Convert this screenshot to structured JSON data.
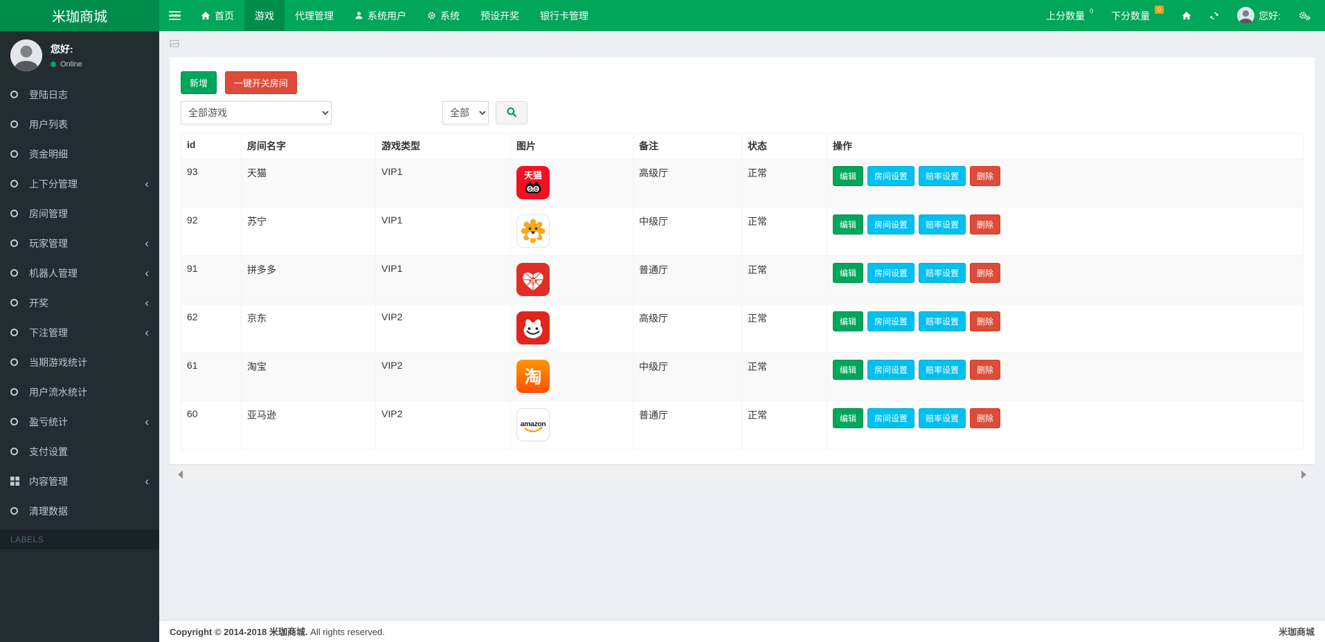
{
  "brand": "米珈商城",
  "navbar": {
    "menu": [
      {
        "name": "home",
        "label": "首页",
        "icon": "home",
        "active": false
      },
      {
        "name": "games",
        "label": "游戏",
        "active": true
      },
      {
        "name": "agents",
        "label": "代理管理",
        "active": false
      },
      {
        "name": "system-users",
        "label": "系统用户",
        "icon": "user",
        "active": false
      },
      {
        "name": "system",
        "label": "系统",
        "icon": "gear",
        "active": false
      },
      {
        "name": "preset-draw",
        "label": "预设开奖",
        "active": false
      },
      {
        "name": "bank-cards",
        "label": "银行卡管理",
        "active": false
      }
    ],
    "right": {
      "score_up_label": "上分数量",
      "score_up_badge": "0",
      "score_down_label": "下分数量",
      "score_down_badge": "0",
      "greeting": "您好:"
    }
  },
  "sidebar": {
    "user": {
      "greeting": "您好:",
      "status": "Online"
    },
    "menu": [
      {
        "name": "login-logs",
        "label": "登陆日志",
        "icon": "circle",
        "expandable": false
      },
      {
        "name": "user-list",
        "label": "用户列表",
        "icon": "circle",
        "expandable": false
      },
      {
        "name": "funds-detail",
        "label": "资金明细",
        "icon": "circle",
        "expandable": false
      },
      {
        "name": "score-management",
        "label": "上下分管理",
        "icon": "circle",
        "expandable": true
      },
      {
        "name": "room-management",
        "label": "房间管理",
        "icon": "circle",
        "expandable": false
      },
      {
        "name": "player-management",
        "label": "玩家管理",
        "icon": "circle",
        "expandable": true
      },
      {
        "name": "robot-management",
        "label": "机器人管理",
        "icon": "circle",
        "expandable": true
      },
      {
        "name": "draw",
        "label": "开奖",
        "icon": "circle",
        "expandable": true
      },
      {
        "name": "bet-management",
        "label": "下注管理",
        "icon": "circle",
        "expandable": true
      },
      {
        "name": "current-game-stats",
        "label": "当期游戏统计",
        "icon": "circle",
        "expandable": false
      },
      {
        "name": "user-flow-stats",
        "label": "用户流水统计",
        "icon": "circle",
        "expandable": false
      },
      {
        "name": "profit-stats",
        "label": "盈亏统计",
        "icon": "circle",
        "expandable": true
      },
      {
        "name": "payment-settings",
        "label": "支付设置",
        "icon": "circle",
        "expandable": false
      },
      {
        "name": "content-management",
        "label": "内容管理",
        "icon": "grid",
        "expandable": true
      },
      {
        "name": "clean-data",
        "label": "清理数据",
        "icon": "circle",
        "expandable": false
      }
    ],
    "labels_header": "LABELS"
  },
  "main": {
    "toolbar": {
      "add": "新增",
      "toggle_rooms": "一键开关房间"
    },
    "filters": {
      "game_select": "全部游戏",
      "status_select": "全部"
    },
    "table": {
      "headers": [
        "id",
        "房间名字",
        "游戏类型",
        "图片",
        "备注",
        "状态",
        "操作"
      ],
      "action_labels": [
        "编辑",
        "房间设置",
        "赔率设置",
        "删除"
      ],
      "rows": [
        {
          "id": "93",
          "name": "天猫",
          "type": "VIP1",
          "icon": "tmall-icon",
          "remark": "高级厅",
          "status": "正常"
        },
        {
          "id": "92",
          "name": "苏宁",
          "type": "VIP1",
          "icon": "suning-icon",
          "remark": "中级厅",
          "status": "正常"
        },
        {
          "id": "91",
          "name": "拼多多",
          "type": "VIP1",
          "icon": "pinduoduo-icon",
          "remark": "普通厅",
          "status": "正常"
        },
        {
          "id": "62",
          "name": "京东",
          "type": "VIP2",
          "icon": "jd-icon",
          "remark": "高级厅",
          "status": "正常"
        },
        {
          "id": "61",
          "name": "淘宝",
          "type": "VIP2",
          "icon": "taobao-icon",
          "remark": "中级厅",
          "status": "正常"
        },
        {
          "id": "60",
          "name": "亚马逊",
          "type": "VIP2",
          "icon": "amazon-icon",
          "remark": "普通厅",
          "status": "正常"
        }
      ]
    },
    "footer": {
      "copyright_bold": "Copyright © 2014-2018 米珈商城.",
      "copyright_rest": "All rights reserved.",
      "right": "米珈商城"
    }
  },
  "colors": {
    "navbar_green": "#00a65a",
    "brand_green": "#008d4c",
    "sidebar_dark": "#222d32",
    "button_red": "#dd4b39",
    "button_cyan": "#00c0ef",
    "badge_orange": "#f39c12",
    "page_bg": "#ecf0f5"
  }
}
